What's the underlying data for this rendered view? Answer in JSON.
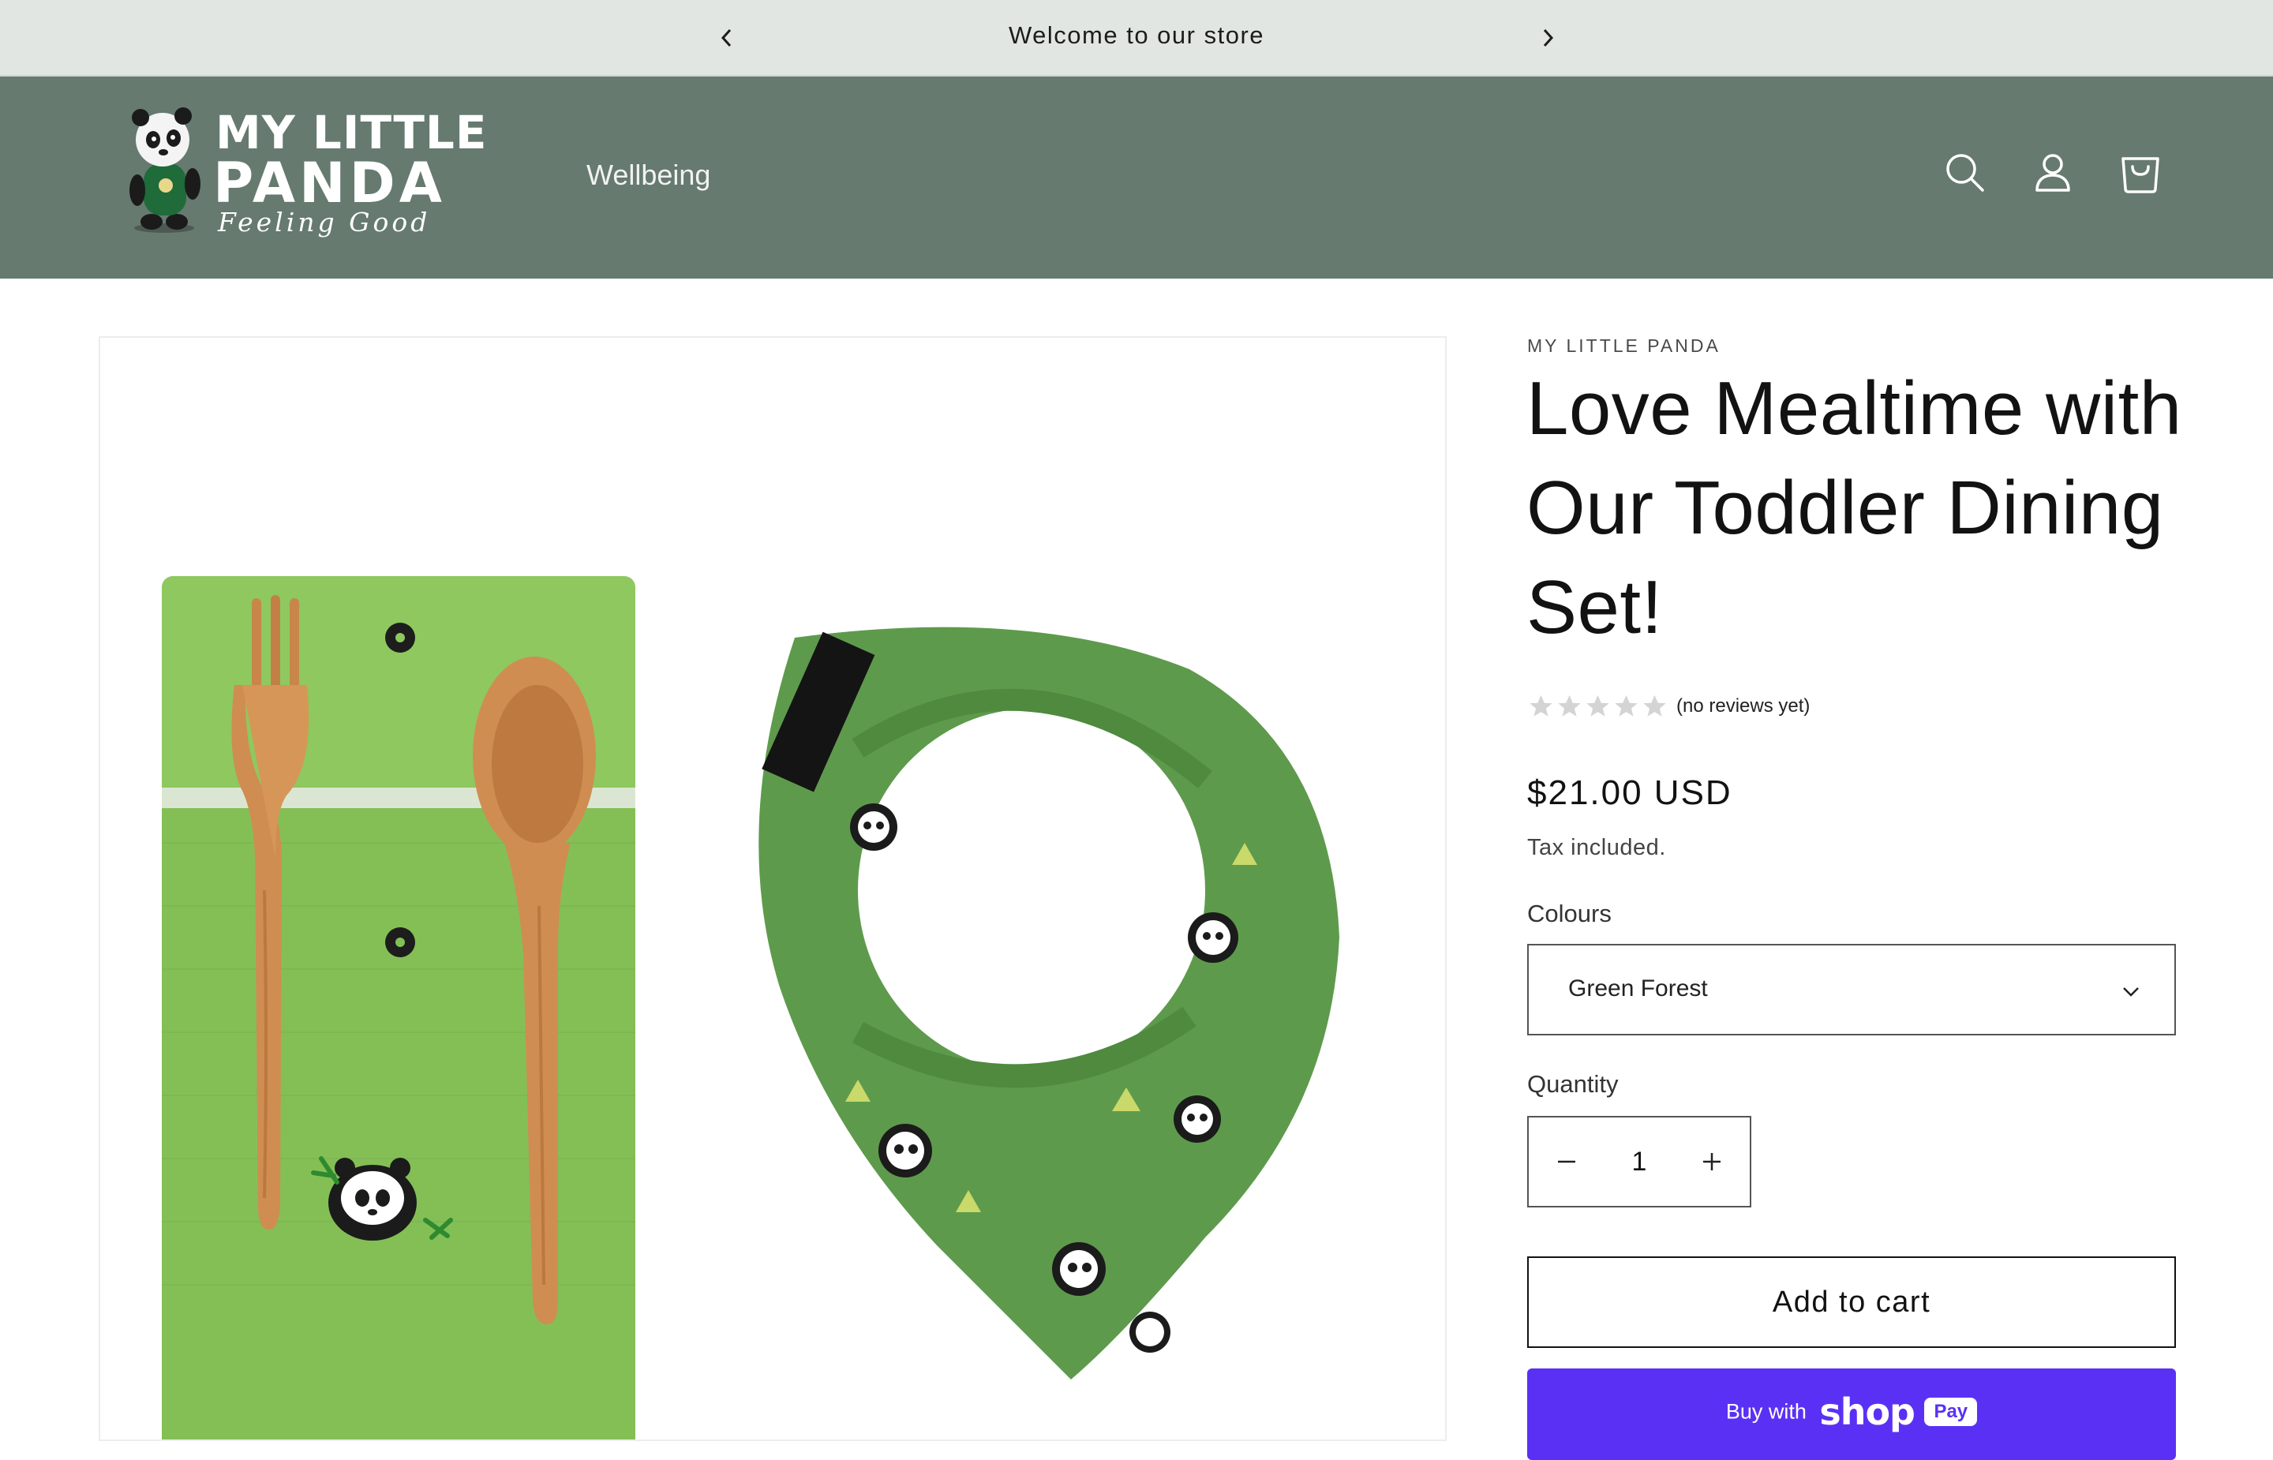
{
  "announcement": {
    "text": "Welcome to our store",
    "prev_icon": "chevron-left-icon",
    "next_icon": "chevron-right-icon"
  },
  "header": {
    "logo": {
      "line1": "MY LITTLE",
      "line2": "PANDA",
      "tagline": "Feeling Good"
    },
    "nav": [
      {
        "label": "Wellbeing"
      }
    ],
    "icons": [
      "search-icon",
      "account-icon",
      "cart-icon"
    ],
    "background": "#667a6f"
  },
  "product": {
    "vendor": "MY LITTLE PANDA",
    "title": "Love Mealtime with Our Toddler Dining Set!",
    "rating": {
      "stars": 0,
      "max": 5,
      "text": "(no reviews yet)"
    },
    "price": "$21.00 USD",
    "tax_note": "Tax included.",
    "colours": {
      "label": "Colours",
      "selected": "Green Forest"
    },
    "quantity": {
      "label": "Quantity",
      "value": "1"
    },
    "add_to_cart_label": "Add to cart",
    "shop_pay": {
      "lead": "Buy with",
      "brand": "shop",
      "badge": "Pay"
    }
  },
  "colors": {
    "announcement_bg": "#e1e6e2",
    "header_bg": "#667a6f",
    "shop_pay": "#5a31f4",
    "canvas_green": "#8ec85f",
    "bib_green": "#5e9a4c",
    "star_empty": "#d4d4d4"
  }
}
